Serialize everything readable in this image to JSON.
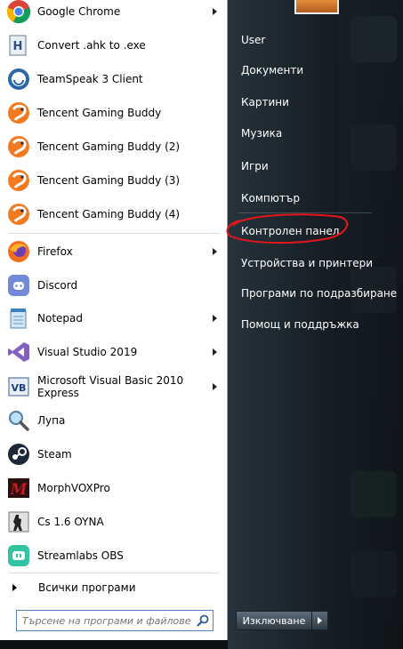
{
  "programs": [
    {
      "label": "Google Chrome",
      "icon": "chrome-icon",
      "has_arrow": true
    },
    {
      "label": "Convert .ahk to .exe",
      "icon": "ahk-converter-icon",
      "has_arrow": false
    },
    {
      "label": "TeamSpeak 3 Client",
      "icon": "teamspeak-icon",
      "has_arrow": false
    },
    {
      "label": "Tencent Gaming Buddy",
      "icon": "tencent-icon",
      "has_arrow": false
    },
    {
      "label": "Tencent Gaming Buddy (2)",
      "icon": "tencent-icon",
      "has_arrow": false
    },
    {
      "label": "Tencent Gaming Buddy (3)",
      "icon": "tencent-icon",
      "has_arrow": false
    },
    {
      "label": "Tencent Gaming Buddy (4)",
      "icon": "tencent-icon",
      "has_arrow": false
    },
    {
      "label": "Firefox",
      "icon": "firefox-icon",
      "has_arrow": true
    },
    {
      "label": "Discord",
      "icon": "discord-icon",
      "has_arrow": false
    },
    {
      "label": "Notepad",
      "icon": "notepad-icon",
      "has_arrow": true
    },
    {
      "label": "Visual Studio 2019",
      "icon": "visual-studio-icon",
      "has_arrow": true
    },
    {
      "label": "Microsoft Visual Basic 2010 Express",
      "icon": "visual-basic-icon",
      "has_arrow": true
    },
    {
      "label": "Лупа",
      "icon": "magnifier-icon",
      "has_arrow": false
    },
    {
      "label": "Steam",
      "icon": "steam-icon",
      "has_arrow": false
    },
    {
      "label": "MorphVOXPro",
      "icon": "morphvox-icon",
      "has_arrow": false
    },
    {
      "label": "Cs 1.6 OYNA",
      "icon": "counter-strike-icon",
      "has_arrow": false
    },
    {
      "label": "Streamlabs OBS",
      "icon": "streamlabs-icon",
      "has_arrow": false
    }
  ],
  "all_programs_label": "Всички програми",
  "search": {
    "placeholder": "Търсене на програми и файлове"
  },
  "right_items": [
    {
      "label": "User"
    },
    {
      "label": "Документи"
    },
    {
      "label": "Картини"
    },
    {
      "label": "Музика"
    },
    {
      "label": "Игри"
    },
    {
      "label": "Компютър"
    },
    {
      "label": "Контролен панел"
    },
    {
      "label": "Устройства и принтери"
    },
    {
      "label": "Програми по подразбиране"
    },
    {
      "label": "Помощ и поддръжка"
    }
  ],
  "shutdown_label": "Изключване",
  "colors": {
    "annotation": "#e8141c",
    "menu_bg": "#ffffff",
    "search_border": "#4a87c3"
  }
}
